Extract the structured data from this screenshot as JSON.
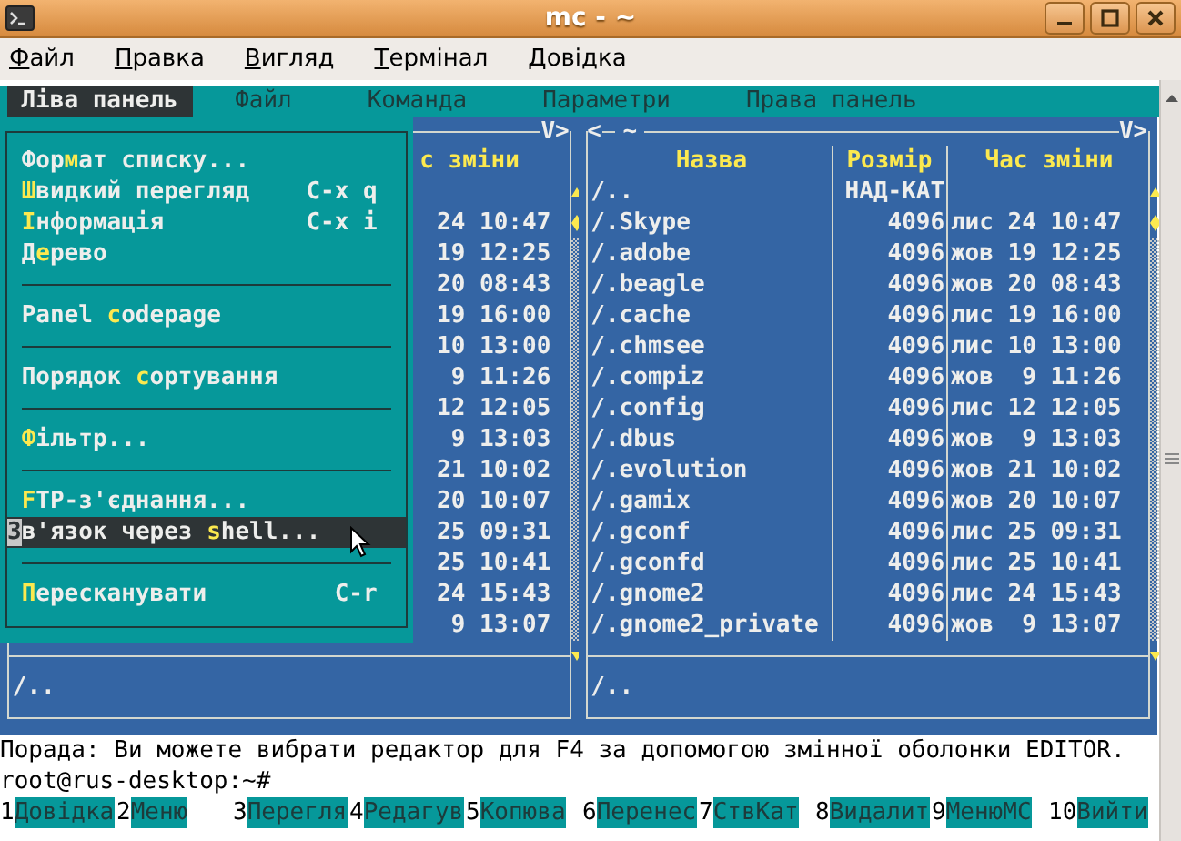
{
  "window": {
    "title": "mc - ~"
  },
  "menu_bar": [
    "Файл",
    "Правка",
    "Вигляд",
    "Термінал",
    "Довідка"
  ],
  "mc_menu": [
    {
      "label": "Ліва панель",
      "selected": true
    },
    {
      "label": "Файл",
      "selected": false
    },
    {
      "label": "Команда",
      "selected": false
    },
    {
      "label": "Параметри",
      "selected": false
    },
    {
      "label": "Права панель",
      "selected": false
    }
  ],
  "dropdown": [
    {
      "kind": "item",
      "pre": "Фор",
      "hotkey": "м",
      "post": "ат списку...",
      "selected": false
    },
    {
      "kind": "item",
      "hotkey": "Ш",
      "post": "видкий перегляд",
      "shortcut": "C-x q",
      "selected": false
    },
    {
      "kind": "item",
      "hotkey": "І",
      "post": "нформація",
      "shortcut": "C-x i",
      "selected": false
    },
    {
      "kind": "item",
      "pre": "Д",
      "hotkey": "е",
      "post": "рево",
      "selected": false
    },
    {
      "kind": "separator"
    },
    {
      "kind": "item",
      "pre": "Panel ",
      "hotkey": "c",
      "post": "odepage",
      "selected": false
    },
    {
      "kind": "separator"
    },
    {
      "kind": "item",
      "pre": "Порядок ",
      "hotkey": "с",
      "post": "ортування",
      "selected": false
    },
    {
      "kind": "separator"
    },
    {
      "kind": "item",
      "hotkey": "Ф",
      "post": "ільтр...",
      "selected": false
    },
    {
      "kind": "separator"
    },
    {
      "kind": "item",
      "hotkey": "F",
      "post": "TP-з'єднання...",
      "selected": false
    },
    {
      "kind": "item",
      "pre": "Зв'язок через ",
      "hotkey": "s",
      "post": "hell...",
      "selected": true
    },
    {
      "kind": "separator"
    },
    {
      "kind": "item",
      "hotkey": "П",
      "post": "ересканувати",
      "shortcut": "C-r",
      "selected": false
    }
  ],
  "left_panel": {
    "nav_right": "V>",
    "header": "с зміни",
    "times": [
      "24 10:47",
      "19 12:25",
      "20 08:43",
      "19 16:00",
      "10 13:00",
      "9 11:26",
      "12 12:05",
      "9 13:03",
      "21 10:02",
      "20 10:07",
      "25 09:31",
      "25 10:41",
      "24 15:43",
      "9 13:07"
    ],
    "status": "/.."
  },
  "right_panel": {
    "nav_left": "<",
    "path": "~",
    "nav_right": "V>",
    "columns": [
      "Назва",
      "Розмір",
      "Час зміни"
    ],
    "rows": [
      {
        "name": "/..",
        "size": "НАД-КАТ"
      },
      {
        "name": "/.Skype",
        "size": "4096",
        "time": "лис 24 10:47"
      },
      {
        "name": "/.adobe",
        "size": "4096",
        "time": "жов 19 12:25"
      },
      {
        "name": "/.beagle",
        "size": "4096",
        "time": "жов 20 08:43"
      },
      {
        "name": "/.cache",
        "size": "4096",
        "time": "лис 19 16:00"
      },
      {
        "name": "/.chmsee",
        "size": "4096",
        "time": "лис 10 13:00"
      },
      {
        "name": "/.compiz",
        "size": "4096",
        "time": "жов  9 11:26"
      },
      {
        "name": "/.config",
        "size": "4096",
        "time": "лис 12 12:05"
      },
      {
        "name": "/.dbus",
        "size": "4096",
        "time": "жов  9 13:03"
      },
      {
        "name": "/.evolution",
        "size": "4096",
        "time": "жов 21 10:02"
      },
      {
        "name": "/.gamix",
        "size": "4096",
        "time": "жов 20 10:07"
      },
      {
        "name": "/.gconf",
        "size": "4096",
        "time": "лис 25 09:31"
      },
      {
        "name": "/.gconfd",
        "size": "4096",
        "time": "лис 25 10:41"
      },
      {
        "name": "/.gnome2",
        "size": "4096",
        "time": "лис 24 15:43"
      },
      {
        "name": "/.gnome2_private",
        "size": "4096",
        "time": "жов  9 13:07"
      }
    ],
    "status": "/.."
  },
  "hint": "Порада: Ви можете вибрати редактор для F4 за допомогою змінної оболонки EDITOR.",
  "prompt": "root@rus-desktop:~#",
  "function_keys": [
    {
      "key": "1",
      "label": "Довідка"
    },
    {
      "key": "2",
      "label": "Меню"
    },
    {
      "key": "3",
      "label": "Перегля"
    },
    {
      "key": "4",
      "label": "Редагув"
    },
    {
      "key": "5",
      "label": "Копюва"
    },
    {
      "key": "6",
      "label": "Перенес"
    },
    {
      "key": "7",
      "label": "СтвКат"
    },
    {
      "key": "8",
      "label": "Видалит"
    },
    {
      "key": "9",
      "label": "МенюМС"
    },
    {
      "key": "10",
      "label": "Вийти"
    }
  ]
}
